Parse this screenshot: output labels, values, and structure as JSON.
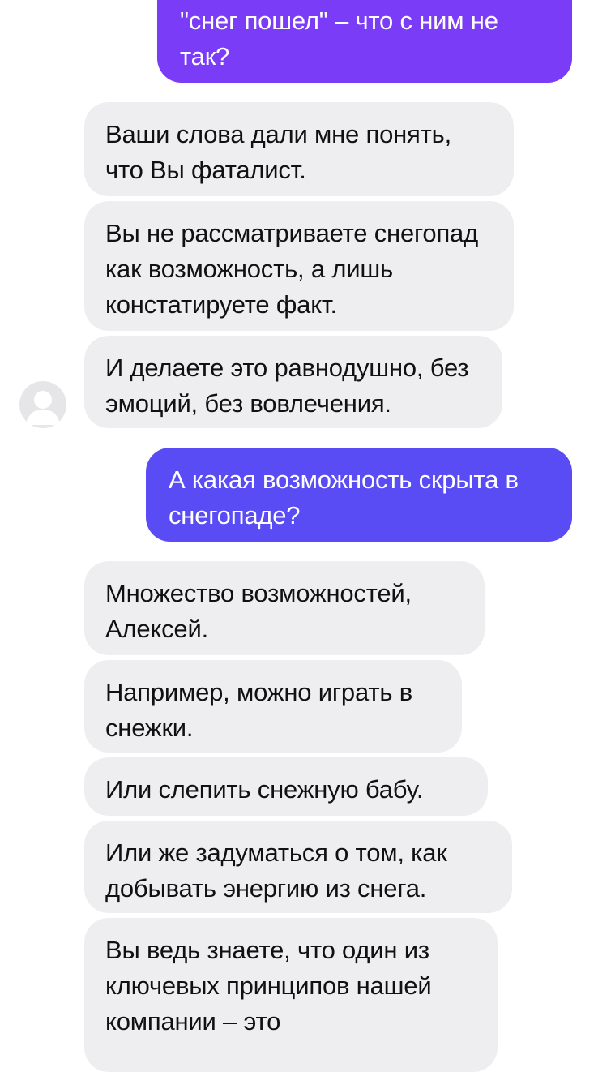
{
  "colors": {
    "outgoing_purple": "#7a3cf7",
    "outgoing_blue_purple": "#5a4cf4",
    "incoming_bg": "#eeeef0"
  },
  "avatar": {
    "icon": "user-avatar-icon"
  },
  "messages": [
    {
      "side": "outgoing",
      "text": "\"снег пошел\" – что с ним не так?"
    },
    {
      "side": "incoming",
      "text": "Ваши слова дали мне понять, что Вы фаталист."
    },
    {
      "side": "incoming",
      "text": "Вы не рассматриваете снегопад как возможность, а лишь констатируете факт."
    },
    {
      "side": "incoming",
      "text": "И делаете это равнодушно, без эмоций, без вовлечения."
    },
    {
      "side": "outgoing",
      "text": "А какая возможность скрыта в снегопаде?"
    },
    {
      "side": "incoming",
      "text": "Множество возможностей, Алексей."
    },
    {
      "side": "incoming",
      "text": "Например, можно играть в снежки."
    },
    {
      "side": "incoming",
      "text": "Или слепить снежную бабу."
    },
    {
      "side": "incoming",
      "text": "Или же задуматься о том, как добывать энергию из снега."
    },
    {
      "side": "incoming",
      "text": "Вы ведь знаете, что один из ключевых принципов нашей компании – это"
    }
  ]
}
